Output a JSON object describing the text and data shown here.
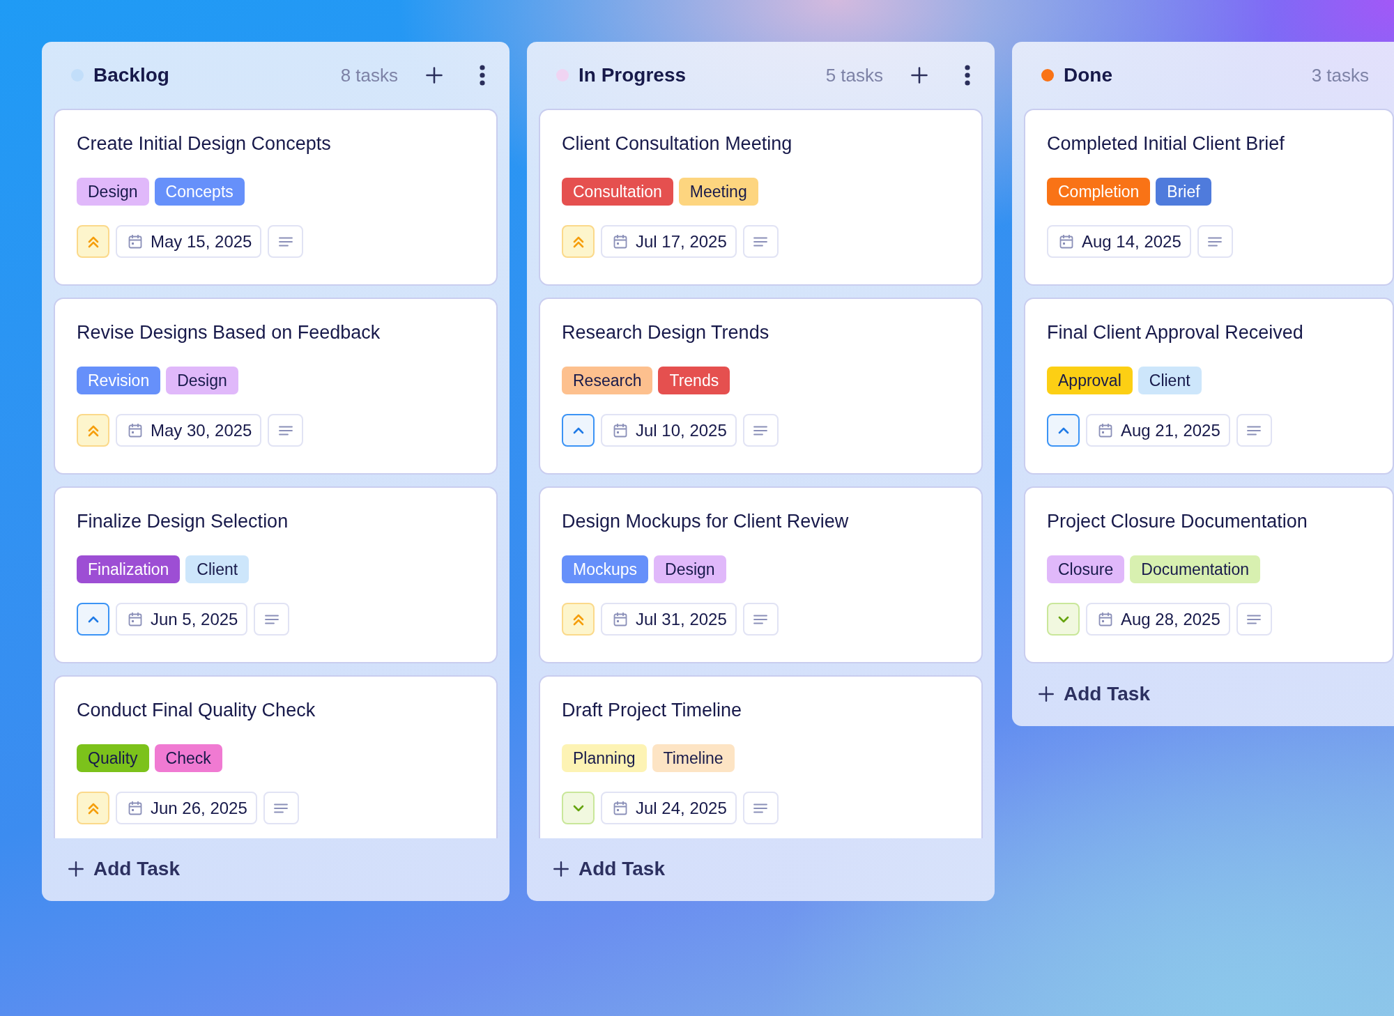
{
  "columns": [
    {
      "title": "Backlog",
      "color": "#c2defa",
      "count": "8 tasks",
      "actions": true,
      "add_label": "Add Task",
      "cards": [
        {
          "title": "Create Initial Design Concepts",
          "kind": "high",
          "date": "May 15, 2025",
          "tags": [
            {
              "label": "Design",
              "color": "#e0b8fa"
            },
            {
              "label": "Concepts",
              "color": "#6690fa"
            }
          ]
        },
        {
          "title": "Revise Designs Based on Feedback",
          "kind": "high",
          "date": "May 30, 2025",
          "tags": [
            {
              "label": "Revision",
              "color": "#6690fa"
            },
            {
              "label": "Design",
              "color": "#e0b8fa"
            }
          ]
        },
        {
          "title": "Finalize Design Selection",
          "kind": "medium",
          "date": "Jun 5, 2025",
          "tags": [
            {
              "label": "Finalization",
              "color": "#9d4ed4"
            },
            {
              "label": "Client",
              "color": "#cde6fb"
            }
          ]
        },
        {
          "title": "Conduct Final Quality Check",
          "kind": "high",
          "date": "Jun 26, 2025",
          "tags": [
            {
              "label": "Quality",
              "color": "#7cc21b"
            },
            {
              "label": "Check",
              "color": "#f07ad2"
            }
          ]
        }
      ]
    },
    {
      "title": "In Progress",
      "color": "#f0d4f2",
      "count": "5 tasks",
      "actions": true,
      "add_label": "Add Task",
      "cards": [
        {
          "title": "Client Consultation Meeting",
          "kind": "high",
          "date": "Jul 17, 2025",
          "tags": [
            {
              "label": "Consultation",
              "color": "#e5504f"
            },
            {
              "label": "Meeting",
              "color": "#fdd57f"
            }
          ]
        },
        {
          "title": "Research Design Trends",
          "kind": "medium",
          "date": "Jul 10, 2025",
          "tags": [
            {
              "label": "Research",
              "color": "#fdc08e"
            },
            {
              "label": "Trends",
              "color": "#e5504f"
            }
          ]
        },
        {
          "title": "Design Mockups for Client Review",
          "kind": "high",
          "date": "Jul 31, 2025",
          "tags": [
            {
              "label": "Mockups",
              "color": "#6690fa"
            },
            {
              "label": "Design",
              "color": "#e0b8fa"
            }
          ]
        },
        {
          "title": "Draft Project Timeline",
          "kind": "low",
          "date": "Jul 24, 2025",
          "tags": [
            {
              "label": "Planning",
              "color": "#fdf3b4"
            },
            {
              "label": "Timeline",
              "color": "#fde4c4"
            }
          ]
        }
      ]
    },
    {
      "title": "Done",
      "color": "#f97316",
      "count": "3 tasks",
      "actions": false,
      "add_label": "Add Task",
      "cards": [
        {
          "title": "Completed Initial Client Brief",
          "kind": "none",
          "date": "Aug 14, 2025",
          "tags": [
            {
              "label": "Completion",
              "color": "#f97316"
            },
            {
              "label": "Brief",
              "color": "#4f7bdc"
            }
          ]
        },
        {
          "title": "Final Client Approval Received",
          "kind": "medium",
          "date": "Aug 21, 2025",
          "tags": [
            {
              "label": "Approval",
              "color": "#fccf14"
            },
            {
              "label": "Client",
              "color": "#cde6fb"
            }
          ]
        },
        {
          "title": "Project Closure Documentation",
          "kind": "low",
          "date": "Aug 28, 2025",
          "tags": [
            {
              "label": "Closure",
              "color": "#e0b8fa"
            },
            {
              "label": "Documentation",
              "color": "#d8f0b0"
            }
          ]
        }
      ]
    }
  ]
}
